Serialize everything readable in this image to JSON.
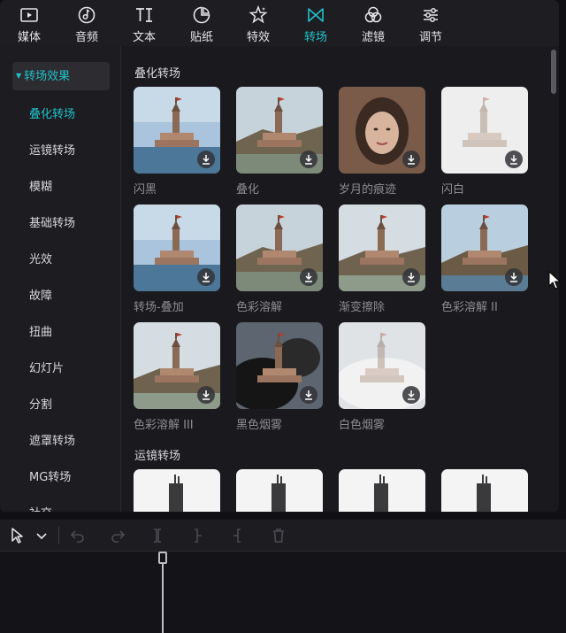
{
  "toolbar": {
    "tabs": [
      {
        "label": "媒体",
        "icon": "media-icon"
      },
      {
        "label": "音频",
        "icon": "audio-icon"
      },
      {
        "label": "文本",
        "icon": "text-icon"
      },
      {
        "label": "贴纸",
        "icon": "sticker-icon"
      },
      {
        "label": "特效",
        "icon": "effects-icon"
      },
      {
        "label": "转场",
        "icon": "transition-icon",
        "active": true
      },
      {
        "label": "滤镜",
        "icon": "filter-icon"
      },
      {
        "label": "调节",
        "icon": "adjust-icon"
      }
    ],
    "accent": "#21c1c9"
  },
  "sidebar": {
    "header": "转场效果",
    "items": [
      "叠化转场",
      "运镜转场",
      "模糊",
      "基础转场",
      "光效",
      "故障",
      "扭曲",
      "幻灯片",
      "分割",
      "遮罩转场",
      "MG转场",
      "社交"
    ]
  },
  "sections": [
    {
      "title": "叠化转场",
      "items": [
        "闪黑",
        "叠化",
        "岁月的痕迹",
        "闪白",
        "转场-叠加",
        "色彩溶解",
        "渐变擦除",
        "色彩溶解 II",
        "色彩溶解 III",
        "黑色烟雾",
        "白色烟雾"
      ]
    },
    {
      "title": "运镜转场",
      "items": [
        "",
        "",
        "",
        ""
      ]
    }
  ]
}
